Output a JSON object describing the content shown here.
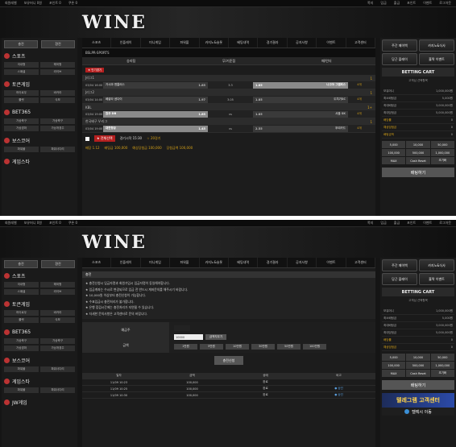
{
  "logo": "WINE",
  "topbar": {
    "left": [
      "회원레벨",
      "보유머니 0원",
      "포인트 0",
      "쿠폰 0"
    ],
    "right": [
      "쪽지",
      "입금",
      "출금",
      "포인트",
      "이벤트",
      "로그아웃"
    ]
  },
  "tabs": [
    "스포츠",
    "인플레이",
    "미니게임",
    "파워볼",
    "카지노&슬롯",
    "베팅내역",
    "경기결과",
    "공지사항",
    "이벤트",
    "고객센터"
  ],
  "sidebar": {
    "buttons": [
      "충전",
      "환전"
    ],
    "sections": [
      {
        "label": "스포츠",
        "items": [
          "국내형",
          "해외형",
          "스페셜",
          "라이브"
        ]
      },
      {
        "label": "토큰게임",
        "items": [
          "하이로우",
          "바카라",
          "룰렛",
          "식보"
        ]
      },
      {
        "label": "BET365",
        "items": [
          "가상축구",
          "가상축구",
          "가상경마",
          "가상개경주"
        ]
      },
      {
        "label": "보스코어",
        "items": [
          "파워볼",
          "파워사다리"
        ]
      },
      {
        "label": "게임스타",
        "items": [
          "파워볼",
          "파워사다리"
        ]
      },
      {
        "label": "JW게임",
        "items": []
      }
    ]
  },
  "right": {
    "promos": [
      "주간 페이백",
      "카지노&식사",
      "당근 플레이",
      "홀짝 이벤트"
    ],
    "cart_title": "BETTING CART",
    "cart_sub": "고객님 선택항목",
    "rows": [
      {
        "label": "보유머니",
        "value": "1,000,000원"
      },
      {
        "label": "최소배팅금",
        "value": "5,000원"
      },
      {
        "label": "최대배팅금",
        "value": "3,000,000원"
      },
      {
        "label": "최대당첨금",
        "value": "5,000,000원"
      },
      {
        "label": "배당률",
        "value": "0"
      },
      {
        "label": "예상당첨금",
        "value": "0"
      },
      {
        "label": "배팅금액",
        "value": "0"
      }
    ],
    "amounts": [
      "5,000",
      "10,000",
      "50,000",
      "100,000",
      "500,000",
      "1,000,000",
      "MAX",
      "Cash Reset",
      "초기화"
    ],
    "bet_button": "배팅하기",
    "cs_banner": "텔레그램 고객센터",
    "telegram": "텔렉시 이동"
  },
  "sports": {
    "header": "BSLPR-SPORTS",
    "markets": [
      "승리팀",
      "무/기준점",
      "패/언더"
    ],
    "tag": "★ 인기경기",
    "leagues": [
      {
        "name": "J리그1",
        "code": "1",
        "games": [
          {
            "time": "03/04 16:00",
            "home": "가시마 앤틀러스",
            "hodd": "1.85",
            "draw": "3.3",
            "away": "나고야 그램퍼스",
            "aodd": "1.85",
            "c": "4개"
          }
        ]
      },
      {
        "name": "J리그2",
        "code": "1",
        "games": [
          {
            "time": "03/04 14:00",
            "home": "베갈타 센다이",
            "hodd": "1.97",
            "draw": "3.05",
            "away": "도치기SC",
            "aodd": "1.85",
            "c": "4개"
          }
        ]
      },
      {
        "name": "KBL",
        "code": "1+",
        "games": [
          {
            "time": "03/04 19:00",
            "home": "원주 DB",
            "hodd": "1.85",
            "draw": "vs",
            "away": "서울 SK",
            "aodd": "1.85",
            "c": "4개"
          }
        ]
      },
      {
        "name": "한국배구 V-리그",
        "code": "1",
        "games": [
          {
            "time": "03/04 19:00",
            "home": "대한항공",
            "hodd": "1.45",
            "draw": "vs",
            "away": "우리카드",
            "aodd": "2.55",
            "c": "4개"
          }
        ]
      }
    ],
    "footer": {
      "cart_btn": "★ 전체선택",
      "time": "경기시작 15:30",
      "count": "☆ 20경기",
      "total_label": "배당 1.12",
      "bet": "배팅금 100,000",
      "win": "예상당첨금 100,000",
      "win2": "당첨금액 100,000"
    }
  },
  "deposit": {
    "title": "충전",
    "notices": [
      "★ 충전신청시 입금자명과 회원가입시 입금자명이 동일해야합니다.",
      "★ 입금계좌는 수시로 변경되므로 입금 전 반드시 계좌문의를 해주시기 바랍니다.",
      "★ 10,000원 이상부터 충전신청이 가능합니다.",
      "★ 수표입금시 충전처리가 불가합니다.",
      "★ 은행 점검시간에는 충전처리가 지연될 수 있습니다.",
      "★ 자세한 문의사항은 고객센터로 문의 바랍니다."
    ],
    "label_name": "예금주",
    "label_amount": "금액",
    "name_value": "",
    "amount_value": "10000",
    "amount_button": "금액지우기",
    "chips": [
      "1만원",
      "5만원",
      "10만원",
      "30만원",
      "50만원",
      "100만원"
    ],
    "submit": "충전신청",
    "history_headers": [
      "일자",
      "금액",
      "상태",
      "비고"
    ],
    "history": [
      {
        "date": "11/09 10:23",
        "amount": "100,000",
        "status": "완료",
        "note": ""
      },
      {
        "date": "11/09 10:25",
        "amount": "100,000",
        "status": "완료",
        "note": "● 승인"
      },
      {
        "date": "11/09 10:30",
        "amount": "100,000",
        "status": "완료",
        "note": "● 승인"
      }
    ]
  }
}
